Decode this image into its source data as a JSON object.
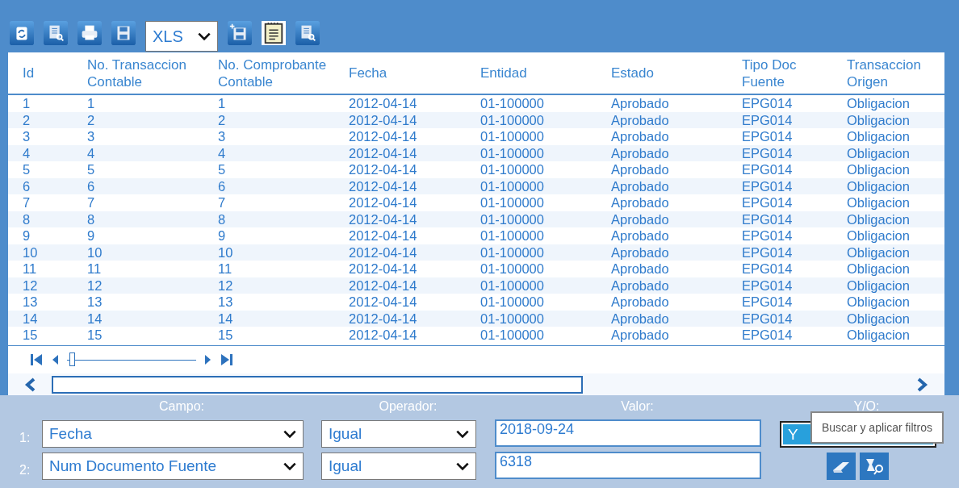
{
  "toolbar": {
    "buttons": [
      {
        "kind": "refresh"
      },
      {
        "kind": "preview"
      },
      {
        "kind": "print"
      },
      {
        "kind": "save"
      }
    ],
    "format": "XLS",
    "buttons_after": [
      {
        "kind": "save-add"
      },
      {
        "kind": "notepad"
      },
      {
        "kind": "preview"
      }
    ]
  },
  "table": {
    "columns": [
      "Id",
      "No. Transaccion\nContable",
      "No. Comprobante\nContable",
      "Fecha",
      "Entidad",
      "Estado",
      "Tipo Doc\nFuente",
      "Transaccion\nOrigen"
    ],
    "rows": [
      [
        "1",
        "1",
        "1",
        "2012-04-14",
        "01-100000",
        "Aprobado",
        "EPG014",
        "Obligacion"
      ],
      [
        "2",
        "2",
        "2",
        "2012-04-14",
        "01-100000",
        "Aprobado",
        "EPG014",
        "Obligacion"
      ],
      [
        "3",
        "3",
        "3",
        "2012-04-14",
        "01-100000",
        "Aprobado",
        "EPG014",
        "Obligacion"
      ],
      [
        "4",
        "4",
        "4",
        "2012-04-14",
        "01-100000",
        "Aprobado",
        "EPG014",
        "Obligacion"
      ],
      [
        "5",
        "5",
        "5",
        "2012-04-14",
        "01-100000",
        "Aprobado",
        "EPG014",
        "Obligacion"
      ],
      [
        "6",
        "6",
        "6",
        "2012-04-14",
        "01-100000",
        "Aprobado",
        "EPG014",
        "Obligacion"
      ],
      [
        "7",
        "7",
        "7",
        "2012-04-14",
        "01-100000",
        "Aprobado",
        "EPG014",
        "Obligacion"
      ],
      [
        "8",
        "8",
        "8",
        "2012-04-14",
        "01-100000",
        "Aprobado",
        "EPG014",
        "Obligacion"
      ],
      [
        "9",
        "9",
        "9",
        "2012-04-14",
        "01-100000",
        "Aprobado",
        "EPG014",
        "Obligacion"
      ],
      [
        "10",
        "10",
        "10",
        "2012-04-14",
        "01-100000",
        "Aprobado",
        "EPG014",
        "Obligacion"
      ],
      [
        "11",
        "11",
        "11",
        "2012-04-14",
        "01-100000",
        "Aprobado",
        "EPG014",
        "Obligacion"
      ],
      [
        "12",
        "12",
        "12",
        "2012-04-14",
        "01-100000",
        "Aprobado",
        "EPG014",
        "Obligacion"
      ],
      [
        "13",
        "13",
        "13",
        "2012-04-14",
        "01-100000",
        "Aprobado",
        "EPG014",
        "Obligacion"
      ],
      [
        "14",
        "14",
        "14",
        "2012-04-14",
        "01-100000",
        "Aprobado",
        "EPG014",
        "Obligacion"
      ],
      [
        "15",
        "15",
        "15",
        "2012-04-14",
        "01-100000",
        "Aprobado",
        "EPG014",
        "Obligacion"
      ]
    ]
  },
  "pager": {
    "level": 0.02
  },
  "filters": {
    "labels": [
      "Campo:",
      "Operador:",
      "Valor:",
      "Y/O:"
    ],
    "rows": [
      {
        "number": "1:",
        "field": "Fecha",
        "operator": "Igual",
        "value": "2018-09-24",
        "conjunction": "Y"
      },
      {
        "number": "2:",
        "field": "Num Documento Fuente",
        "operator": "Igual",
        "value": "6318"
      }
    ],
    "tooltip": "Buscar y aplicar filtros",
    "actions": [
      {
        "kind": "eraser"
      },
      {
        "kind": "search"
      }
    ]
  }
}
